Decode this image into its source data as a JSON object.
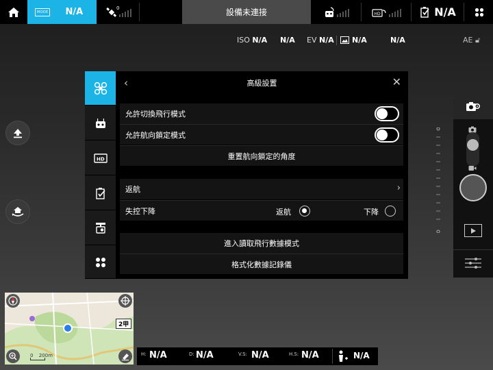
{
  "topbar": {
    "mode_badge": "MODE",
    "mode_value": "N/A",
    "satellite_count": "0",
    "status": "設備未連接",
    "nav_value": "N/A"
  },
  "exposure": {
    "iso_label": "ISO",
    "iso_value": "N/A",
    "shutter_value": "N/A",
    "ev_label": "EV",
    "ev_value": "N/A",
    "format_value": "N/A",
    "remaining_value": "N/A",
    "ae_label": "AE"
  },
  "panel": {
    "title": "高級設置",
    "allow_switch_flight_mode": "允許切換飛行模式",
    "allow_course_lock_mode": "允許航向鎖定模式",
    "reset_course_lock_angle": "重置航向鎖定的角度",
    "return_home": "返航",
    "fc_failsafe": "失控下降",
    "option_return": "返航",
    "option_descend": "下降",
    "enter_flight_data_mode": "進入讀取飛行數據模式",
    "format_data_recorder": "格式化數據記錄儀",
    "toggles": {
      "switch_flight_mode": true,
      "course_lock_mode": true
    },
    "failsafe_selected": "返航"
  },
  "map": {
    "scale_start": "0",
    "scale_label": "200m",
    "badge": "2甲"
  },
  "telemetry": {
    "h_label": "H:",
    "h_value": "N/A",
    "d_label": "D:",
    "d_value": "N/A",
    "vs_label": "V.S:",
    "vs_value": "N/A",
    "hs_label": "H.S:",
    "hs_value": "N/A",
    "dist_value": "N/A"
  },
  "colors": {
    "accent": "#1cb4e6",
    "background": "#2a2a2a",
    "panel": "#000000"
  }
}
